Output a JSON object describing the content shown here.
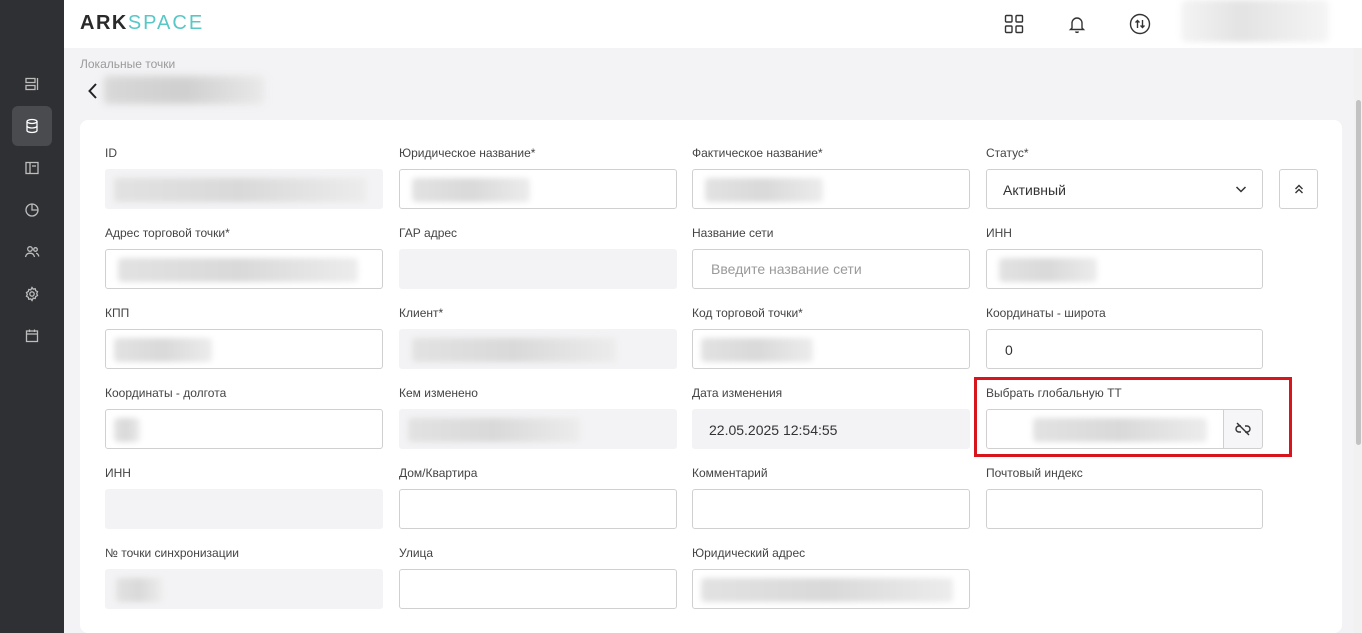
{
  "app": {
    "logo_ark": "ARK",
    "logo_space": "SPACE"
  },
  "header": {
    "icons": [
      "apps-grid-icon",
      "bell-icon",
      "sync-arrows-icon"
    ]
  },
  "sidebar": {
    "items": [
      {
        "icon": "list-icon",
        "active": false
      },
      {
        "icon": "database-icon",
        "active": true
      },
      {
        "icon": "layout-icon",
        "active": false
      },
      {
        "icon": "pie-chart-icon",
        "active": false
      },
      {
        "icon": "users-icon",
        "active": false
      },
      {
        "icon": "gear-icon",
        "active": false
      },
      {
        "icon": "calendar-icon",
        "active": false
      }
    ]
  },
  "breadcrumb": "Локальные точки",
  "form": {
    "id": {
      "label": "ID"
    },
    "legal_name": {
      "label": "Юридическое название*"
    },
    "actual_name": {
      "label": "Фактическое название*"
    },
    "status": {
      "label": "Статус*",
      "value": "Активный"
    },
    "address": {
      "label": "Адрес торговой точки*"
    },
    "gar_address": {
      "label": "ГАР адрес"
    },
    "network_name": {
      "label": "Название сети",
      "placeholder": "Введите название сети"
    },
    "inn": {
      "label": "ИНН"
    },
    "kpp": {
      "label": "КПП"
    },
    "client": {
      "label": "Клиент*"
    },
    "point_code": {
      "label": "Код торговой точки*"
    },
    "latitude": {
      "label": "Координаты - широта",
      "value": "0"
    },
    "longitude": {
      "label": "Координаты - долгота"
    },
    "changed_by": {
      "label": "Кем изменено"
    },
    "changed_date": {
      "label": "Дата изменения",
      "value": "22.05.2025 12:54:55"
    },
    "global_tt": {
      "label": "Выбрать глобальную ТТ"
    },
    "inn2": {
      "label": "ИНН"
    },
    "house": {
      "label": "Дом/Квартира"
    },
    "comment": {
      "label": "Комментарий"
    },
    "postal": {
      "label": "Почтовый индекс"
    },
    "sync_point": {
      "label": "№ точки синхронизации"
    },
    "street": {
      "label": "Улица"
    },
    "legal_address": {
      "label": "Юридический адрес"
    }
  },
  "colors": {
    "highlight": "#d6151c",
    "sidebar": "#2f3033",
    "accent": "#58c7c7"
  }
}
